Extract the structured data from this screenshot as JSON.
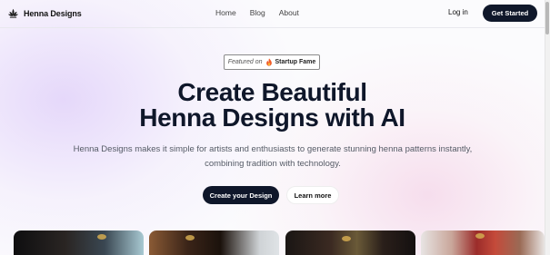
{
  "header": {
    "brand_name": "Henna Designs",
    "nav": [
      {
        "label": "Home"
      },
      {
        "label": "Blog"
      },
      {
        "label": "About"
      }
    ],
    "login_label": "Log in",
    "cta_label": "Get Started"
  },
  "hero": {
    "featured": {
      "prefix": "Featured on",
      "brand": "Startup Fame",
      "icon": "flame-icon"
    },
    "headline_line1": "Create Beautiful",
    "headline_line2": "Henna Designs with AI",
    "subtext_line1": "Henna Designs makes it simple for artists and enthusiasts to generate stunning henna patterns instantly,",
    "subtext_line2": "combining tradition with technology.",
    "primary_button": "Create your Design",
    "secondary_button": "Learn more"
  },
  "gallery": {
    "cards": [
      {
        "kind": "henna-photo"
      },
      {
        "kind": "henna-photo"
      },
      {
        "kind": "henna-photo"
      },
      {
        "kind": "henna-photo"
      }
    ]
  },
  "colors": {
    "primary": "#0f172a",
    "accent_purple": "#e4d6fa",
    "accent_pink": "#f6dcec"
  }
}
